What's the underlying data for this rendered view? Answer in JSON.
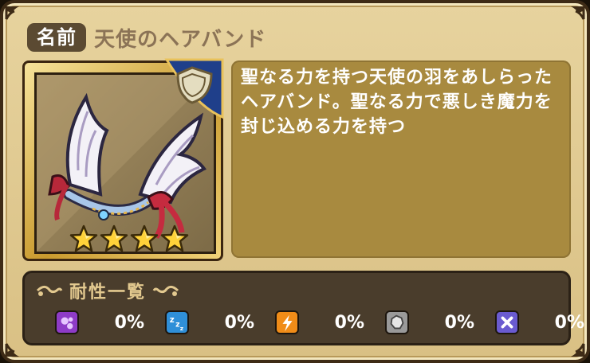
{
  "item": {
    "name_label": "名前",
    "name": "天使のヘアバンド",
    "description": "聖なる力を持つ天使の羽をあしらったヘアバンド。聖なる力で悪しき魔力を封じ込める力を持つ",
    "stars": 4,
    "category_icon": "shield-icon"
  },
  "resistance": {
    "title": "耐性一覧",
    "items": [
      {
        "icon": "poison-icon",
        "color": "#8e3bc7",
        "value": "0%"
      },
      {
        "icon": "sleep-icon",
        "color": "#2f8fd8",
        "value": "0%"
      },
      {
        "icon": "paralysis-icon",
        "color": "#f08c18",
        "value": "0%"
      },
      {
        "icon": "seal-icon",
        "color": "#9a9a9a",
        "value": "0%"
      },
      {
        "icon": "curse-icon",
        "color": "#6a5bd0",
        "value": "0%"
      }
    ]
  }
}
